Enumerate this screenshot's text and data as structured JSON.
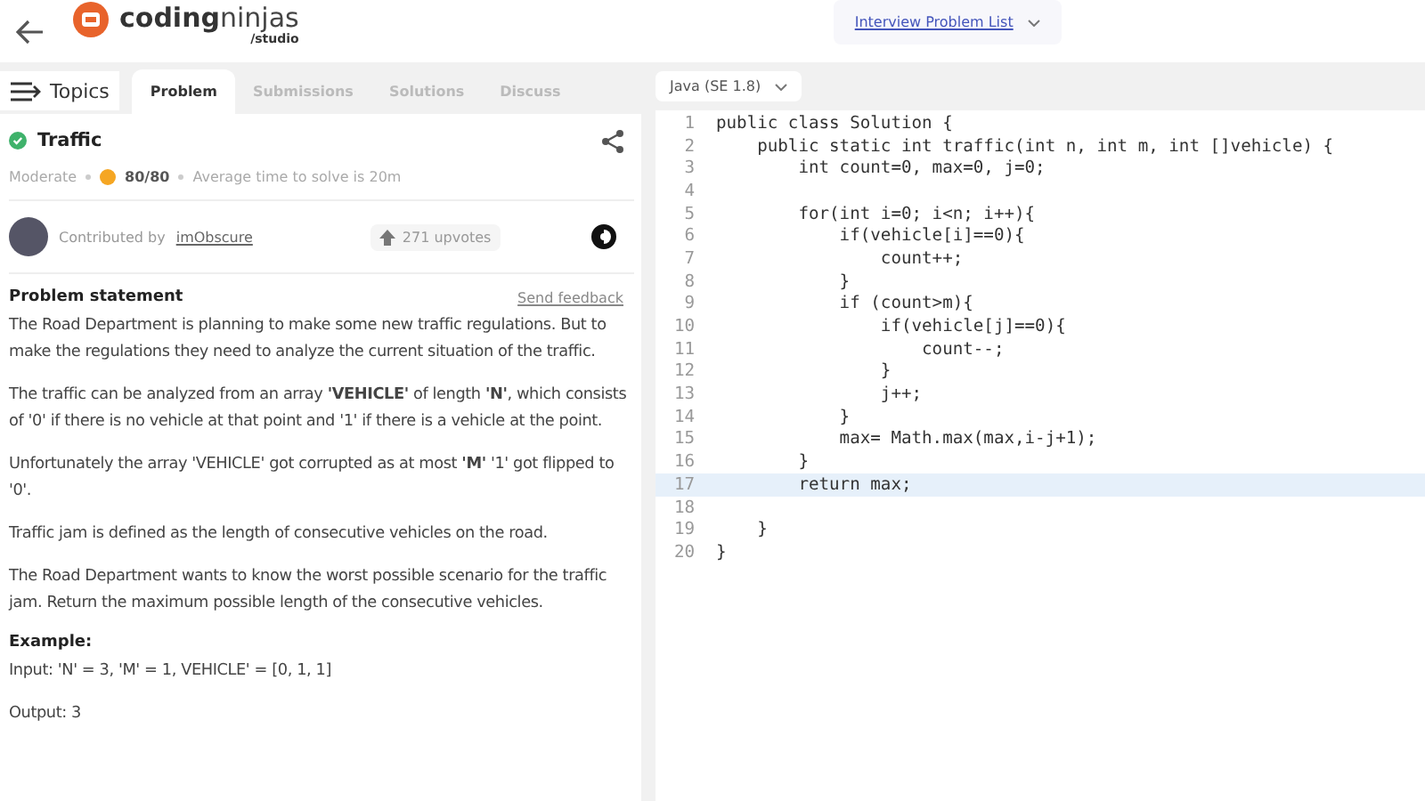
{
  "header": {
    "logo_word_1": "coding",
    "logo_word_2": "ninjas",
    "logo_sub": "/studio",
    "list_link": "Interview Problem List"
  },
  "topics_button": "Topics",
  "tabs": [
    {
      "label": "Problem",
      "selected": true
    },
    {
      "label": "Submissions",
      "selected": false
    },
    {
      "label": "Solutions",
      "selected": false
    },
    {
      "label": "Discuss",
      "selected": false
    }
  ],
  "problem": {
    "title": "Traffic",
    "solved": true,
    "difficulty": "Moderate",
    "score": "80/80",
    "avg_time": "Average time to solve is 20m",
    "contributor_label": "Contributed by",
    "contributor": "imObscure",
    "upvotes": "271 upvotes",
    "statement_heading": "Problem statement",
    "feedback_link": "Send feedback",
    "paragraphs": [
      "The Road Department is planning to make some new traffic regulations. But to make the regulations they need to analyze the current situation of the traffic.",
      "The traffic can be analyzed from an array **'VEHICLE'** of length **'N'**, which consists of '0' if there is no vehicle at that point and '1' if there is a vehicle at the point.",
      "Unfortunately the array 'VEHICLE' got corrupted as at most **'M'** '1' got flipped to '0'.",
      "Traffic jam is defined as the length of consecutive vehicles on the road.",
      "The Road Department wants to know the worst possible scenario for the traffic jam. Return the maximum possible length of the consecutive vehicles."
    ],
    "example_heading": "Example:",
    "example_input": "Input: 'N' = 3, 'M' = 1, VEHICLE' = [0, 1, 1]",
    "example_output": "Output: 3"
  },
  "editor": {
    "language": "Java (SE 1.8)",
    "lines": [
      {
        "number": "1",
        "text": "public class Solution {",
        "current": false
      },
      {
        "number": "2",
        "text": "    public static int traffic(int n, int m, int []vehicle) {",
        "current": false
      },
      {
        "number": "3",
        "text": "        int count=0, max=0, j=0;",
        "current": false
      },
      {
        "number": "4",
        "current": false
      },
      {
        "number": "5",
        "text": "        for(int i=0; i<n; i++){",
        "current": false
      },
      {
        "number": "6",
        "text": "            if(vehicle[i]==0){",
        "current": false
      },
      {
        "number": "7",
        "text": "                count++;",
        "current": false
      },
      {
        "number": "8",
        "text": "            }",
        "current": false
      },
      {
        "number": "9",
        "text": "            if (count>m){",
        "current": false
      },
      {
        "number": "10",
        "text": "                if(vehicle[j]==0){",
        "current": false
      },
      {
        "number": "11",
        "text": "                    count--;",
        "current": false
      },
      {
        "number": "12",
        "text": "                }",
        "current": false
      },
      {
        "number": "13",
        "text": "                j++;",
        "current": false
      },
      {
        "number": "14",
        "text": "            }",
        "current": false
      },
      {
        "number": "15",
        "text": "            max= Math.max(max,i-j+1);",
        "current": false
      },
      {
        "number": "16",
        "text": "        }",
        "current": false
      },
      {
        "number": "17",
        "text": "        return max;",
        "current": true
      },
      {
        "number": "18",
        "current": false
      },
      {
        "number": "19",
        "text": "    }",
        "current": false
      },
      {
        "number": "20",
        "text": "}",
        "current": false
      }
    ]
  }
}
